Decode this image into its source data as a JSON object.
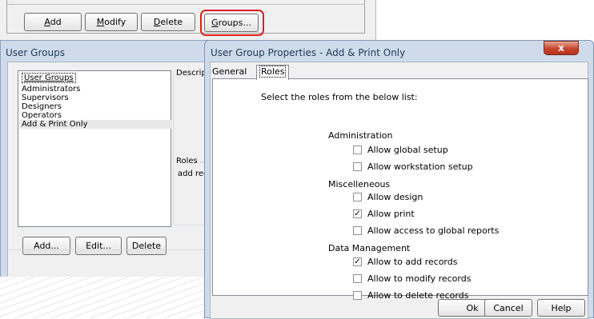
{
  "top_window": {
    "buttons": [
      "Add",
      "Modify",
      "Delete",
      "Groups..."
    ]
  },
  "user_groups": {
    "title": "User Groups",
    "list_header": "User Groups",
    "groups": [
      "Administrators",
      "Supervisors",
      "Designers",
      "Operators",
      "Add & Print Only"
    ],
    "selected_index": 4,
    "description_label": "Descripti",
    "roles_label": "Roles",
    "roles_value": "add reco",
    "buttons": {
      "add": "Add...",
      "edit": "Edit...",
      "delete": "Delete"
    }
  },
  "dialog": {
    "title": "User Group Properties - Add & Print Only",
    "close_glyph": "x",
    "tabs": {
      "general": "General",
      "roles": "Roles"
    },
    "instruction": "Select the roles from the below list:",
    "sections": [
      {
        "label": "Administration",
        "options": [
          {
            "label": "Allow global setup",
            "checked": false
          },
          {
            "label": "Allow workstation setup",
            "checked": false
          }
        ]
      },
      {
        "label": "Miscelleneous",
        "options": [
          {
            "label": "Allow design",
            "checked": false
          },
          {
            "label": "Allow print",
            "checked": true
          },
          {
            "label": "Allow access to global reports",
            "checked": false
          }
        ]
      },
      {
        "label": "Data Management",
        "options": [
          {
            "label": "Allow to add records",
            "checked": true
          },
          {
            "label": "Allow to modify records",
            "checked": false
          },
          {
            "label": "Allow to delete records",
            "checked": false
          }
        ]
      }
    ],
    "buttons": {
      "ok": "Ok",
      "cancel": "Cancel",
      "help": "Help"
    },
    "check_glyph": "✓"
  }
}
